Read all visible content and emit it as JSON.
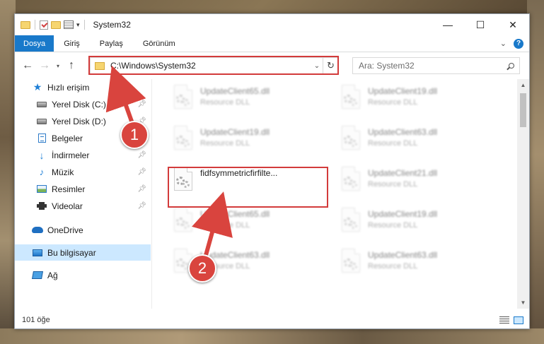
{
  "window": {
    "title": "System32",
    "controls": {
      "minimize": "—",
      "maximize": "☐",
      "close": "✕"
    }
  },
  "ribbon": {
    "tabs": [
      "Dosya",
      "Giriş",
      "Paylaş",
      "Görünüm"
    ],
    "active_tab": "Dosya"
  },
  "address": {
    "path": "C:\\Windows\\System32",
    "search_placeholder": "Ara: System32"
  },
  "sidebar": {
    "items": [
      {
        "label": "Hızlı erişim",
        "icon": "star-icon",
        "pinned": false
      },
      {
        "label": "Yerel Disk (C:)",
        "icon": "drive-icon",
        "pinned": true
      },
      {
        "label": "Yerel Disk (D:)",
        "icon": "drive-icon",
        "pinned": true
      },
      {
        "label": "Belgeler",
        "icon": "documents-icon",
        "pinned": true
      },
      {
        "label": "İndirmeler",
        "icon": "downloads-icon",
        "pinned": true
      },
      {
        "label": "Müzik",
        "icon": "music-icon",
        "pinned": true
      },
      {
        "label": "Resimler",
        "icon": "pictures-icon",
        "pinned": true
      },
      {
        "label": "Videolar",
        "icon": "videos-icon",
        "pinned": true
      },
      {
        "label": "OneDrive",
        "icon": "cloud-icon",
        "pinned": false
      },
      {
        "label": "Bu bilgisayar",
        "icon": "computer-icon",
        "pinned": false,
        "selected": true
      },
      {
        "label": "Ağ",
        "icon": "network-icon",
        "pinned": false
      }
    ]
  },
  "files": [
    {
      "name": "UpdateClient65.dll",
      "type": "Resource DLL"
    },
    {
      "name": "UpdateClient19.dll",
      "type": "Resource DLL"
    },
    {
      "name": "UpdateClient19.dll",
      "type": "Resource DLL"
    },
    {
      "name": "UpdateClient63.dll",
      "type": "Resource DLL"
    },
    {
      "name": "fidfsymmetricfirfilte...",
      "type": ""
    },
    {
      "name": "UpdateClient21.dll",
      "type": "Resource DLL"
    },
    {
      "name": "UpdateClient65.dll",
      "type": "Resource DLL"
    },
    {
      "name": "UpdateClient19.dll",
      "type": "Resource DLL"
    },
    {
      "name": "UpdateClient63.dll",
      "type": "Resource DLL"
    },
    {
      "name": "UpdateClient63.dll",
      "type": "Resource DLL"
    }
  ],
  "status": {
    "count": "101 öğe"
  },
  "annotations": {
    "badge1": "1",
    "badge2": "2",
    "highlight_color": "#d33b3b"
  },
  "colors": {
    "accent": "#1979ca",
    "selection": "#cce8ff"
  }
}
